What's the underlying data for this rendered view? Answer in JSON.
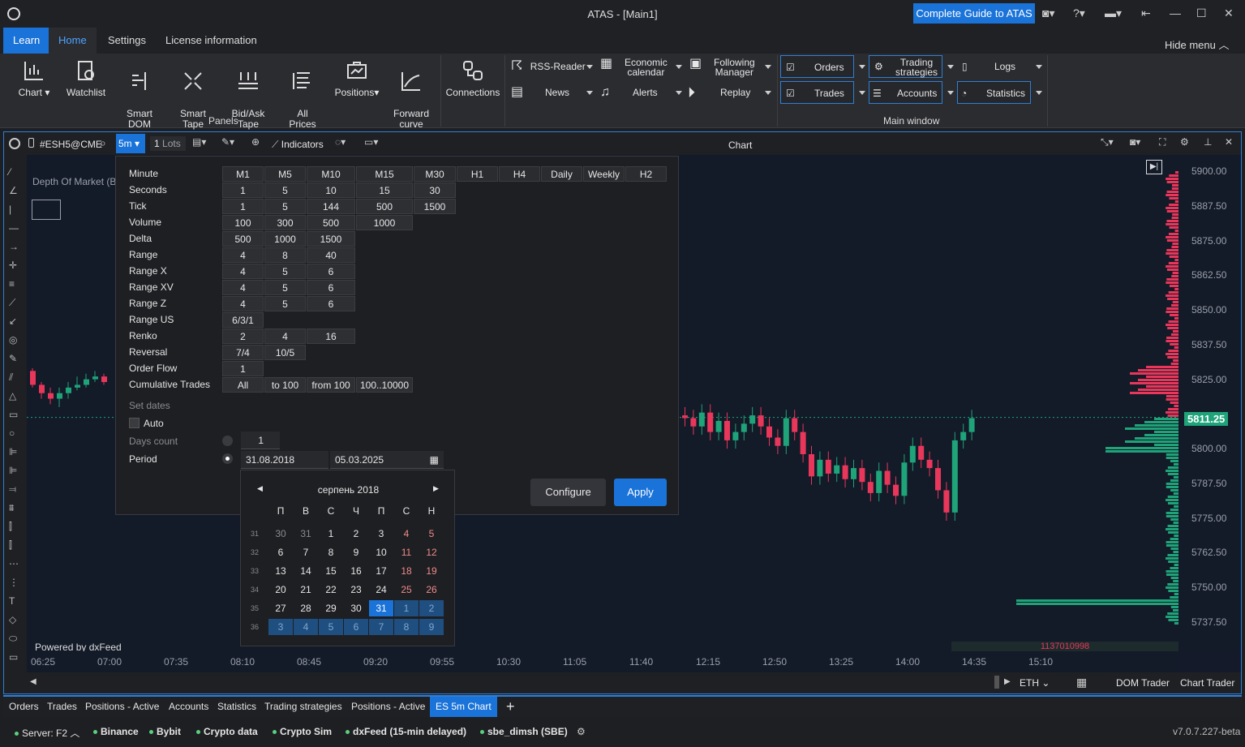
{
  "window": {
    "title": "ATAS - [Main1]",
    "guide_button": "Complete Guide to ATAS"
  },
  "ribbon_tabs": [
    "Learn",
    "Home",
    "Settings",
    "License information"
  ],
  "hide_menu": "Hide menu",
  "panels": {
    "chart": "Chart",
    "watchlist": "Watchlist",
    "smart_dom": "Smart\nDOM",
    "smart_tape": "Smart\nTape",
    "bidask_tape": "Bid/Ask\nTape",
    "all_prices": "All\nPrices",
    "positions": "Positions",
    "forward_curve": "Forward\ncurve",
    "group_label": "Panels"
  },
  "connections": "Connections",
  "tools": {
    "rss": "RSS-Reader",
    "econ": "Economic\ncalendar",
    "following": "Following\nManager",
    "news": "News",
    "alerts": "Alerts",
    "replay": "Replay"
  },
  "main_window": {
    "orders": "Orders",
    "trading_strategies": "Trading\nstrategies",
    "logs": "Logs",
    "trades": "Trades",
    "accounts": "Accounts",
    "statistics": "Statistics",
    "group_label": "Main window"
  },
  "chart_header": {
    "symbol": "#ESH5@CME",
    "timeframe": "5m",
    "lots": "1",
    "lots_label": "Lots",
    "indicators": "Indicators",
    "title": "Chart"
  },
  "overlay": {
    "dom_label": "Depth Of Market (B",
    "powered": "Powered by dxFeed"
  },
  "timeframes": {
    "headers": [
      "M1",
      "M5",
      "M10",
      "M15",
      "M30",
      "H1",
      "H4",
      "Daily",
      "Weekly",
      "H2"
    ],
    "rows": [
      {
        "label": "Minute",
        "values": []
      },
      {
        "label": "Seconds",
        "values": [
          "1",
          "5",
          "10",
          "15",
          "30"
        ]
      },
      {
        "label": "Tick",
        "values": [
          "1",
          "5",
          "144",
          "500",
          "1500"
        ]
      },
      {
        "label": "Volume",
        "values": [
          "100",
          "300",
          "500",
          "1000"
        ]
      },
      {
        "label": "Delta",
        "values": [
          "500",
          "1000",
          "1500"
        ]
      },
      {
        "label": "Range",
        "values": [
          "4",
          "8",
          "40"
        ]
      },
      {
        "label": "Range X",
        "values": [
          "4",
          "5",
          "6"
        ]
      },
      {
        "label": "Range XV",
        "values": [
          "4",
          "5",
          "6"
        ]
      },
      {
        "label": "Range Z",
        "values": [
          "4",
          "5",
          "6"
        ]
      },
      {
        "label": "Range US",
        "values": [
          "6/3/1"
        ]
      },
      {
        "label": "Renko",
        "values": [
          "2",
          "4",
          "16"
        ]
      },
      {
        "label": "Reversal",
        "values": [
          "7/4",
          "10/5"
        ]
      },
      {
        "label": "Order Flow",
        "values": [
          "1"
        ]
      },
      {
        "label": "Cumulative Trades",
        "values": [
          "All",
          "to 100",
          "from 100",
          "100..10000"
        ]
      }
    ],
    "set_dates": "Set dates",
    "auto": "Auto",
    "days_count": "Days count",
    "days_value": "1",
    "period": "Period",
    "date_from": "31.08.2018",
    "date_to": "05.03.2025",
    "configure": "Configure",
    "apply": "Apply"
  },
  "calendar": {
    "month": "серпень 2018",
    "weekdays": [
      "П",
      "В",
      "С",
      "Ч",
      "П",
      "С",
      "Н"
    ],
    "weeks": [
      {
        "num": "31",
        "days": [
          "30",
          "31",
          "1",
          "2",
          "3",
          "4",
          "5"
        ]
      },
      {
        "num": "32",
        "days": [
          "6",
          "7",
          "8",
          "9",
          "10",
          "11",
          "12"
        ]
      },
      {
        "num": "33",
        "days": [
          "13",
          "14",
          "15",
          "16",
          "17",
          "18",
          "19"
        ]
      },
      {
        "num": "34",
        "days": [
          "20",
          "21",
          "22",
          "23",
          "24",
          "25",
          "26"
        ]
      },
      {
        "num": "35",
        "days": [
          "27",
          "28",
          "29",
          "30",
          "31",
          "1",
          "2"
        ]
      },
      {
        "num": "36",
        "days": [
          "3",
          "4",
          "5",
          "6",
          "7",
          "8",
          "9"
        ]
      }
    ]
  },
  "price_axis": [
    "5900.00",
    "5887.50",
    "5875.00",
    "5862.50",
    "5850.00",
    "5837.50",
    "5825.00",
    "5811.25",
    "5800.00",
    "5787.50",
    "5775.00",
    "5762.50",
    "5750.00",
    "5737.50"
  ],
  "current_price": "5811.25",
  "volume_label": "1137010998",
  "time_axis": [
    "06:25",
    "07:00",
    "07:35",
    "08:10",
    "08:45",
    "09:20",
    "09:55",
    "10:30",
    "11:05",
    "11:40",
    "12:15",
    "12:50",
    "13:25",
    "14:00",
    "14:35",
    "15:10"
  ],
  "chart_footer": {
    "session": "ETH",
    "dom_trader": "DOM Trader",
    "chart_trader": "Chart Trader"
  },
  "bottom_tabs": [
    "Orders",
    "Trades",
    "Positions - Active",
    "Accounts",
    "Statistics",
    "Trading strategies",
    "Positions - Active",
    "ES 5m Chart"
  ],
  "status": {
    "server": "Server: F2",
    "connections": [
      "Binance",
      "Bybit",
      "Crypto data",
      "Crypto Sim",
      "dxFeed (15-min delayed)",
      "sbe_dimsh (SBE)"
    ],
    "version": "v7.0.7.227-beta"
  },
  "colors": {
    "accent": "#1a73d9",
    "up": "#1fa47a",
    "down": "#e8375b",
    "bg": "#131a28"
  }
}
